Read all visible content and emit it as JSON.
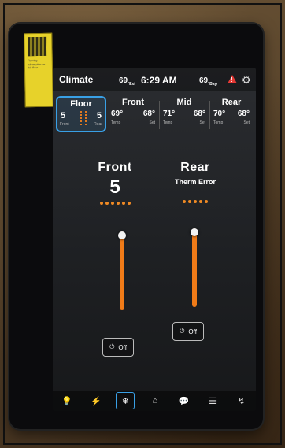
{
  "header": {
    "title": "Climate",
    "temp_exterior": "69",
    "temp_exterior_unit": "°Ext",
    "time": "6:29 AM",
    "temp_bay": "69",
    "temp_bay_unit": "°Bay"
  },
  "zones": {
    "floor": {
      "name": "Floor",
      "front_value": "5",
      "rear_value": "5",
      "front_label": "Front",
      "rear_label": "Rear"
    },
    "front": {
      "name": "Front",
      "temp": "69°",
      "set": "68°",
      "temp_label": "Temp",
      "set_label": "Set"
    },
    "mid": {
      "name": "Mid",
      "temp": "71°",
      "set": "68°",
      "temp_label": "Temp",
      "set_label": "Set"
    },
    "rear": {
      "name": "Rear",
      "temp": "70°",
      "set": "68°",
      "temp_label": "Temp",
      "set_label": "Set"
    }
  },
  "controls": {
    "front": {
      "title": "Front",
      "value": "5",
      "level": 0.95,
      "off_label": "Off"
    },
    "rear": {
      "title": "Rear",
      "error": "Therm Error",
      "level": 0.95,
      "off_label": "Off"
    }
  },
  "sticker": {
    "text": "Flooring Information on this floor"
  },
  "colors": {
    "accent": "#39a0e6",
    "slider": "#f07b18",
    "warning": "#e53935"
  },
  "nav": {
    "items": [
      {
        "icon": "lightbulb-icon",
        "glyph": "💡"
      },
      {
        "icon": "power-bolt-icon",
        "glyph": "⚡"
      },
      {
        "icon": "snowflake-icon",
        "glyph": "❄"
      },
      {
        "icon": "home-icon",
        "glyph": "⌂"
      },
      {
        "icon": "chat-icon",
        "glyph": "💬"
      },
      {
        "icon": "grid-icon",
        "glyph": "☰"
      },
      {
        "icon": "signal-icon",
        "glyph": "↯"
      }
    ],
    "active_index": 2
  }
}
